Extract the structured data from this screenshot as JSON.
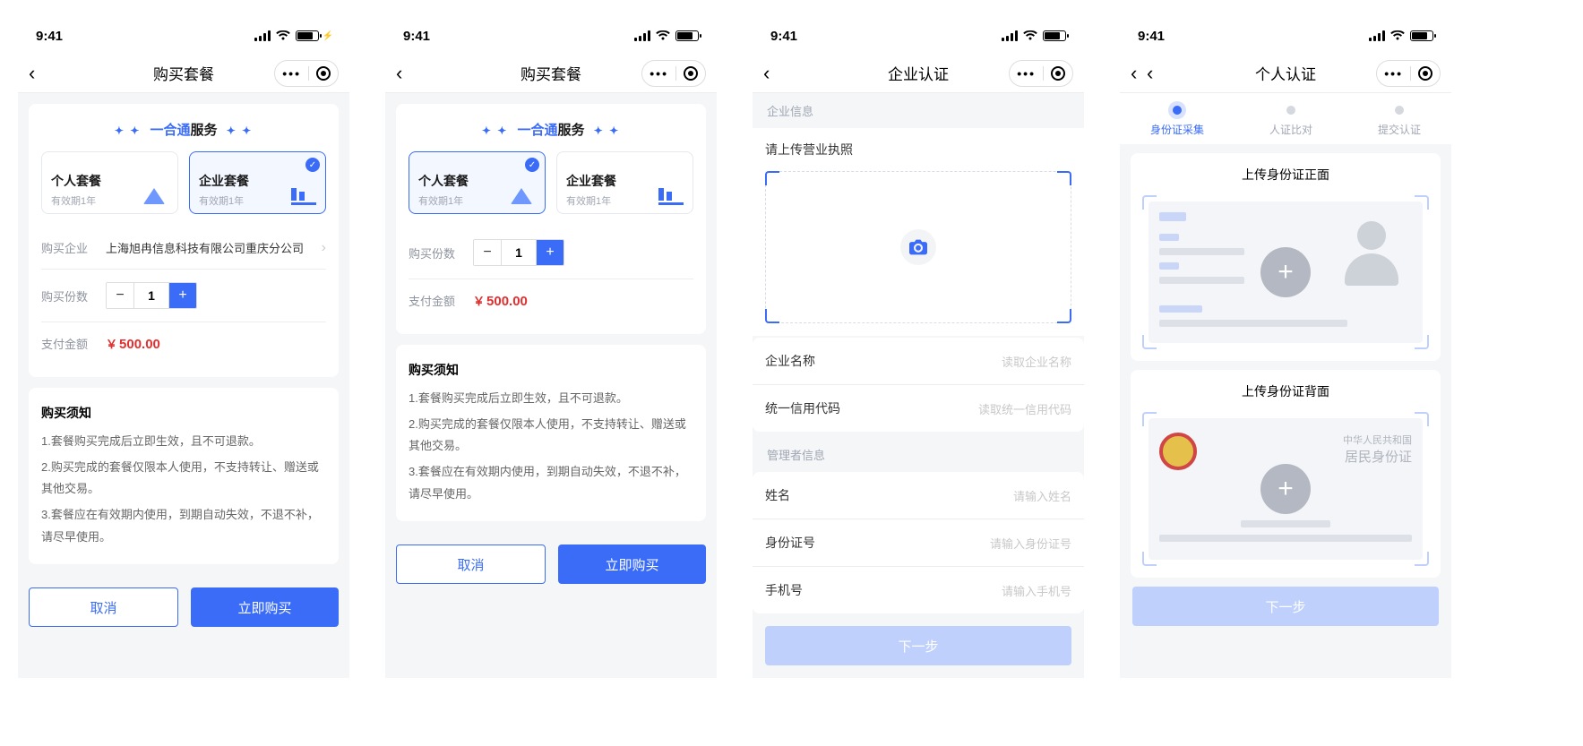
{
  "status": {
    "time": "9:41"
  },
  "screen1": {
    "nav": {
      "title": "购买套餐"
    },
    "service_prefix": "一合通",
    "service_suffix": "服务",
    "plans": {
      "personal": {
        "title": "个人套餐",
        "sub": "有效期1年"
      },
      "enterprise": {
        "title": "企业套餐",
        "sub": "有效期1年"
      },
      "selected": "enterprise"
    },
    "company_label": "购买企业",
    "company_value": "上海旭冉信息科技有限公司重庆分公司",
    "qty_label": "购买份数",
    "qty_value": "1",
    "amount_label": "支付金额",
    "amount_value": "500.00",
    "amount_symbol": "￥",
    "notice_title": "购买须知",
    "notices": [
      "1.套餐购买完成后立即生效，且不可退款。",
      "2.购买完成的套餐仅限本人使用，不支持转让、赠送或其他交易。",
      "3.套餐应在有效期内使用，到期自动失效，不退不补，请尽早使用。"
    ],
    "btn_cancel": "取消",
    "btn_buy": "立即购买"
  },
  "screen2": {
    "nav": {
      "title": "购买套餐"
    },
    "service_prefix": "一合通",
    "service_suffix": "服务",
    "plans": {
      "personal": {
        "title": "个人套餐",
        "sub": "有效期1年"
      },
      "enterprise": {
        "title": "企业套餐",
        "sub": "有效期1年"
      },
      "selected": "personal"
    },
    "qty_label": "购买份数",
    "qty_value": "1",
    "amount_label": "支付金额",
    "amount_value": "500.00",
    "amount_symbol": "￥",
    "notice_title": "购买须知",
    "notices": [
      "1.套餐购买完成后立即生效，且不可退款。",
      "2.购买完成的套餐仅限本人使用，不支持转让、赠送或其他交易。",
      "3.套餐应在有效期内使用，到期自动失效，不退不补，请尽早使用。"
    ],
    "btn_cancel": "取消",
    "btn_buy": "立即购买"
  },
  "screen3": {
    "nav": {
      "title": "企业认证"
    },
    "sec1": "企业信息",
    "upload_title": "请上传营业执照",
    "fields1": [
      {
        "k": "企业名称",
        "p": "读取企业名称"
      },
      {
        "k": "统一信用代码",
        "p": "读取统一信用代码"
      }
    ],
    "sec2": "管理者信息",
    "fields2": [
      {
        "k": "姓名",
        "p": "请输入姓名"
      },
      {
        "k": "身份证号",
        "p": "请输入身份证号"
      },
      {
        "k": "手机号",
        "p": "请输入手机号"
      }
    ],
    "btn_next": "下一步"
  },
  "screen4": {
    "nav": {
      "title": "个人认证"
    },
    "steps": [
      {
        "label": "身份证采集",
        "active": true
      },
      {
        "label": "人证比对",
        "active": false
      },
      {
        "label": "提交认证",
        "active": false
      }
    ],
    "id_front_title": "上传身份证正面",
    "id_back_title": "上传身份证背面",
    "back_l1": "中华人民共和国",
    "back_l2": "居民身份证",
    "btn_next": "下一步"
  }
}
